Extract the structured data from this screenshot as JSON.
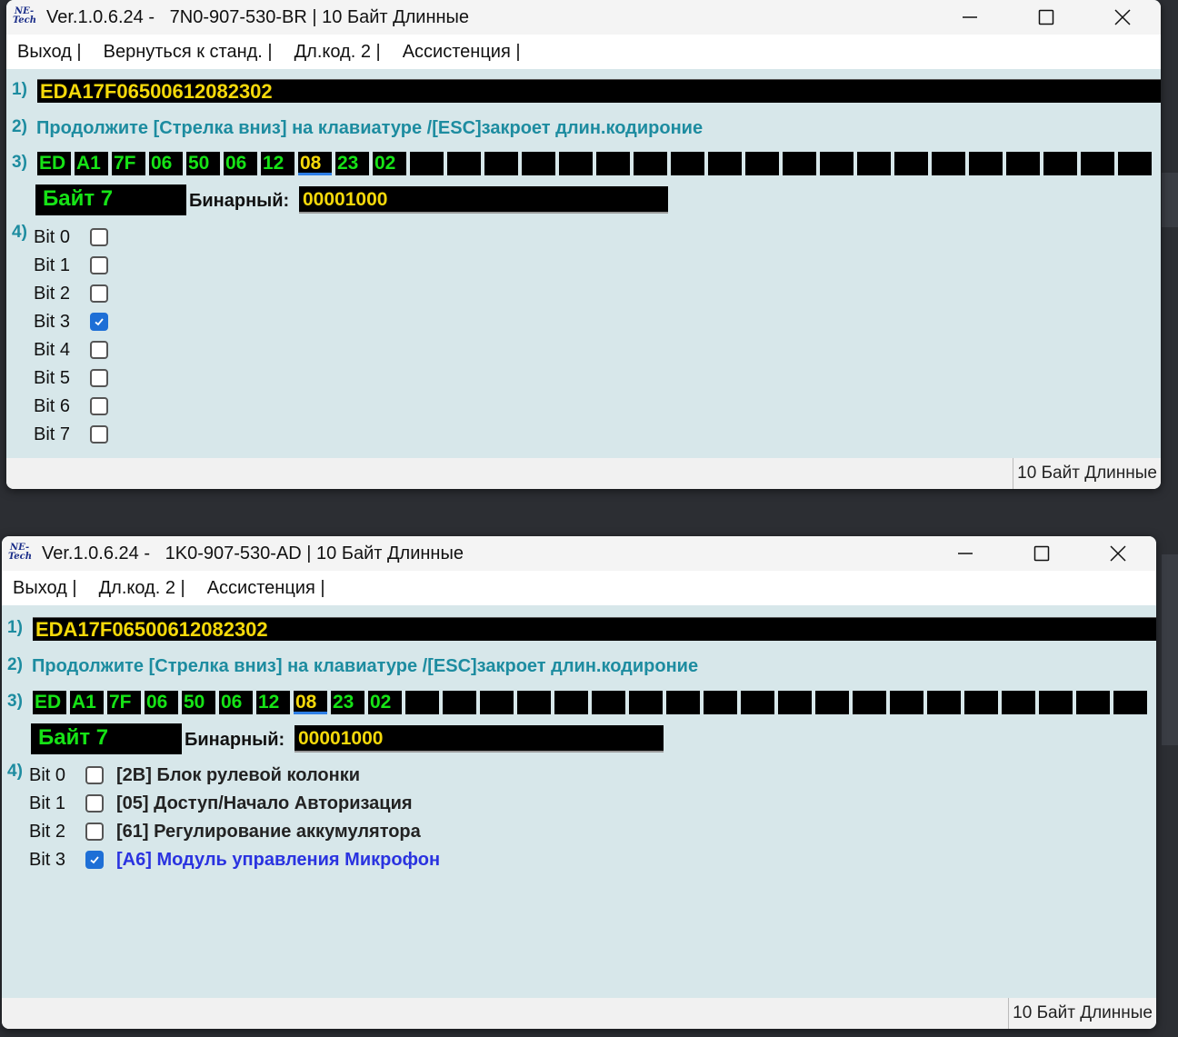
{
  "win1": {
    "title": "Ver.1.0.6.24 -   7N0-907-530-BR | 10 Байт Длинные",
    "menu": [
      "Выход |",
      "Вернуться к станд. |",
      "Дл.код. 2 |",
      "Ассистенция |"
    ],
    "n1": "1)",
    "n2": "2)",
    "n3": "3)",
    "n4": "4)",
    "code": "EDA17F06500612082302",
    "hint": "Продолжите [Стрелка вниз] на клавиатуре /[ESC]закроет длин.кодироние",
    "bytes": [
      "ED",
      "A1",
      "7F",
      "06",
      "50",
      "06",
      "12",
      "08",
      "23",
      "02"
    ],
    "selected_byte": 7,
    "empty_cells": 20,
    "byte_label": "Байт 7",
    "binary_label": "Бинарный:",
    "binary_value": "00001000",
    "bits": [
      {
        "label": "Bit 0",
        "checked": false
      },
      {
        "label": "Bit 1",
        "checked": false
      },
      {
        "label": "Bit 2",
        "checked": false
      },
      {
        "label": "Bit 3",
        "checked": true
      },
      {
        "label": "Bit 4",
        "checked": false
      },
      {
        "label": "Bit 5",
        "checked": false
      },
      {
        "label": "Bit 6",
        "checked": false
      },
      {
        "label": "Bit 7",
        "checked": false
      }
    ],
    "status": "10 Байт Длинные"
  },
  "win2": {
    "title": "Ver.1.0.6.24 -   1K0-907-530-AD | 10 Байт Длинные",
    "menu": [
      "Выход |",
      "Дл.код. 2 |",
      "Ассистенция |"
    ],
    "n1": "1)",
    "n2": "2)",
    "n3": "3)",
    "n4": "4)",
    "code": "EDA17F06500612082302",
    "hint": "Продолжите [Стрелка вниз] на клавиатуре /[ESC]закроет длин.кодироние",
    "bytes": [
      "ED",
      "A1",
      "7F",
      "06",
      "50",
      "06",
      "12",
      "08",
      "23",
      "02"
    ],
    "selected_byte": 7,
    "empty_cells": 20,
    "byte_label": "Байт 7",
    "binary_label": "Бинарный:",
    "binary_value": "00001000",
    "bits": [
      {
        "label": "Bit 0",
        "checked": false,
        "desc": "[2B] Блок рулевой колонки"
      },
      {
        "label": "Bit 1",
        "checked": false,
        "desc": "[05] Доступ/Начало Авторизация"
      },
      {
        "label": "Bit 2",
        "checked": false,
        "desc": "[61] Регулирование аккумулятора"
      },
      {
        "label": "Bit 3",
        "checked": true,
        "desc": "[A6] Модуль управления Микрофон"
      }
    ],
    "status": "10 Байт Длинные"
  },
  "colors": {
    "window_bg": "#d7e7ea",
    "hex_green": "#16e316",
    "code_yellow": "#f5d90a",
    "label_teal": "#1d8ca0",
    "checkbox_blue": "#1e6fd6",
    "highlight_blue": "#2a33e0"
  },
  "icons": [
    "app-logo-icon",
    "minimize-icon",
    "maximize-icon",
    "close-icon",
    "check-icon"
  ]
}
